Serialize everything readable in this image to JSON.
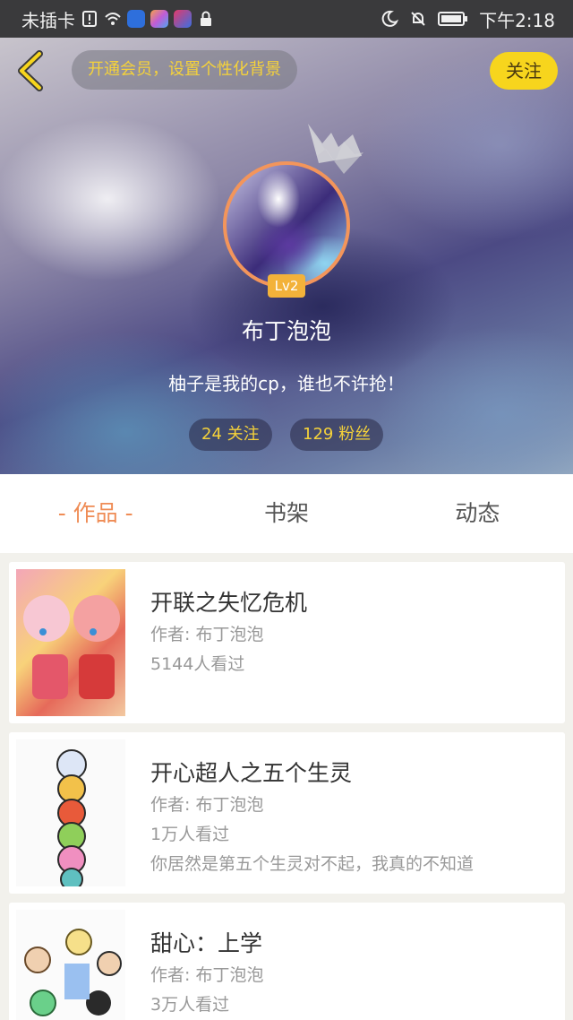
{
  "status_bar": {
    "left_text": "未插卡",
    "time": "下午2:18"
  },
  "header": {
    "vip_banner": "开通会员，设置个性化背景",
    "follow_label": "关注",
    "level": "Lv2",
    "username": "布丁泡泡",
    "bio": "柚子是我的cp，谁也不许抢！",
    "following": "24 关注",
    "fans": "129 粉丝"
  },
  "tabs": [
    {
      "label": "- 作品 -",
      "active": true
    },
    {
      "label": "书架",
      "active": false
    },
    {
      "label": "动态",
      "active": false
    }
  ],
  "works": [
    {
      "title": "开联之失忆危机",
      "author": "作者: 布丁泡泡",
      "views": "5144人看过",
      "desc": ""
    },
    {
      "title": "开心超人之五个生灵",
      "author": "作者: 布丁泡泡",
      "views": "1万人看过",
      "desc": "你居然是第五个生灵对不起，我真的不知道"
    },
    {
      "title": "甜心：上学",
      "author": "作者: 布丁泡泡",
      "views": "3万人看过",
      "desc": ""
    }
  ],
  "colors": {
    "accent": "#ef8c55",
    "follow_button": "#f7d51d",
    "banner_text": "#f5d23a"
  }
}
